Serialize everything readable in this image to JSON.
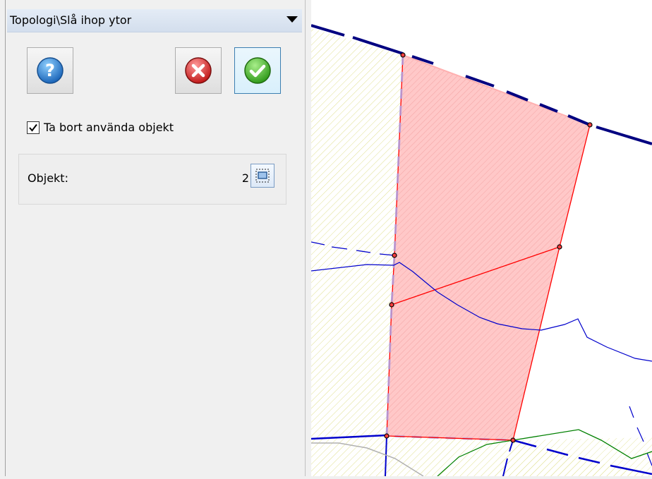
{
  "panel": {
    "title": "Topologi\\Slå ihop ytor",
    "icons": {
      "dropdown": "triangle-down-icon",
      "help": "question-mark-icon",
      "cancel": "red-x-icon",
      "ok": "green-checkmark-icon",
      "select": "select-window-icon"
    },
    "checkbox": {
      "label": "Ta bort använda objekt",
      "checked": true
    },
    "objekt": {
      "label": "Objekt:",
      "count": "2"
    }
  },
  "colors": {
    "selection_fill": "#ffc8c8",
    "selection_edge": "#ff0000",
    "boundary_blue": "#0000cc",
    "road_navy": "#000080",
    "green_line": "#008000",
    "hatch_yellow": "#e0e090",
    "dashed_lavender": "#b0a0e0"
  }
}
